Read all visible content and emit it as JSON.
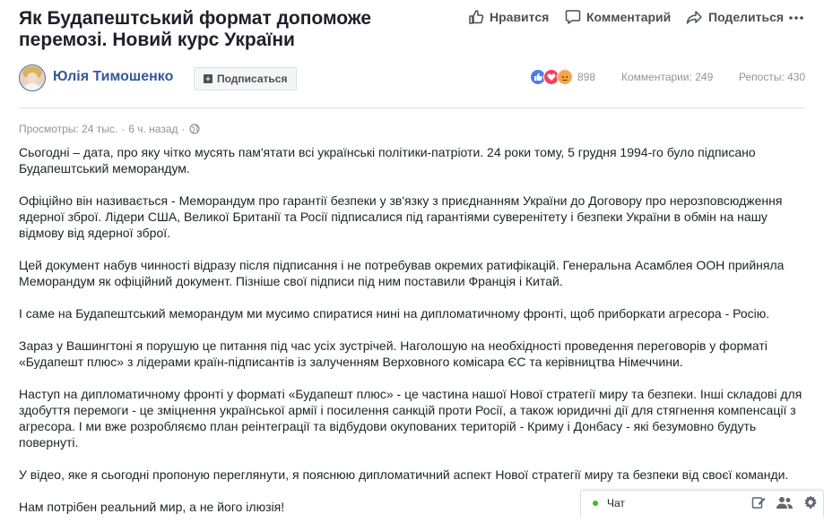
{
  "post": {
    "title": "Як Будапештський формат допоможе перемозі. Новий курс України",
    "author": "Юлія Тимошенко",
    "subscribe_label": "Подписаться",
    "reactions_count": "898",
    "comments": "Комментарии: 249",
    "reposts": "Репосты: 430",
    "views": "Просмотры: 24 тыс.",
    "time": "6 ч. назад",
    "paragraphs": [
      "Сьогодні – дата, про яку чітко мусять пам'ятати всі українські політики-патріоти. 24 роки тому, 5 грудня 1994-го було підписано Будапештський меморандум.",
      "Офіційно він називається - Меморандум про гарантії безпеки у зв'язку з приєднанням України до Договору про нерозповсюдження ядерної зброї. Лідери США, Великої Британії та Росії підписалися під гарантіями суверенітету і безпеки України в обмін на нашу відмову від ядерної зброї.",
      "Цей документ набув чинності відразу після підписання і не потребував окремих ратифікацій. Генеральна Асамблея ООН прийняла Меморандум як офіційний документ. Пізніше свої підписи під ним поставили Франція і Китай.",
      "І саме на Будапештський меморандум ми мусимо спиратися нині на дипломатичному фронті, щоб приборкати агресора - Росію.",
      "Зараз у Вашингтоні я порушую це питання під час усіх зустрічей. Наголошую на необхідності проведення переговорів у форматі «Будапешт плюс» з лідерами країн-підписантів із залученням Верховного комісара ЄС та керівництва Німеччини.",
      "Наступ на дипломатичному фронті у форматі «Будапешт плюс» - це частина нашої Нової стратегії миру та безпеки. Інші складові для здобуття перемоги - це зміцнення української армії і посилення санкцій проти Росії, а також юридичні дії для стягнення компенсації з агресора. І ми вже розробляємо план реінтеграції та відбудови окупованих територій - Криму і Донбасу - які безумовно будуть повернуті.",
      "У відео, яке я сьогодні пропоную переглянути, я пояснюю дипломатичний аспект Нової стратегії миру та безпеки від своєї команди.",
      "Нам потрібен реальний мир, а не його ілюзія!"
    ]
  },
  "actions": {
    "like_label": "Нравится",
    "comment_label": "Комментарий",
    "share_label": "Поделиться"
  },
  "chat": {
    "label": "Чат"
  },
  "icons": {
    "like": "thumbs-up-icon",
    "comment": "speech-bubble-icon",
    "share": "share-arrow-icon",
    "more": "more-dots-icon",
    "globe": "globe-icon",
    "compose": "compose-icon",
    "people": "people-icon",
    "settings": "gear-icon"
  },
  "colors": {
    "link": "#365899",
    "text": "#1d2129",
    "muted": "#90949c",
    "online": "#42b72a"
  }
}
